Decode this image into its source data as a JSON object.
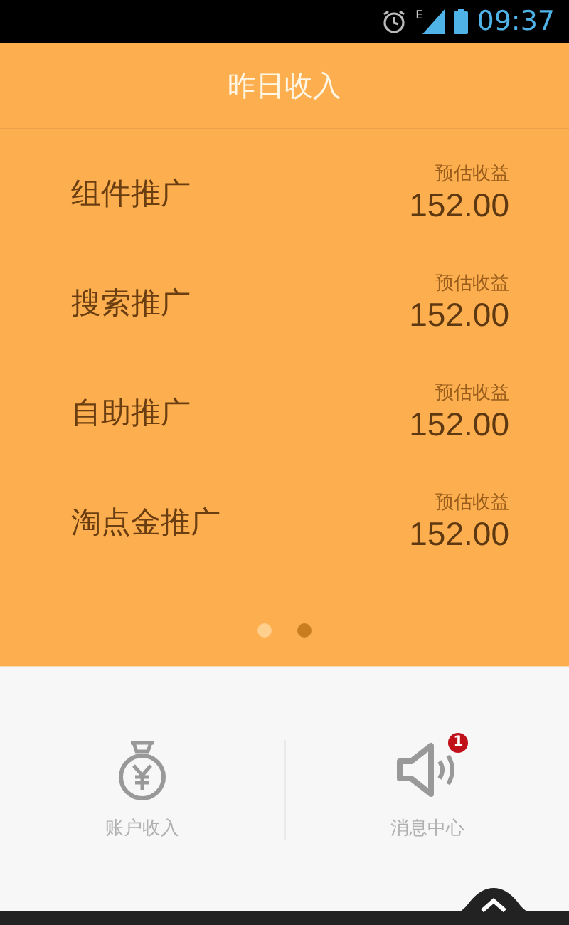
{
  "status_bar": {
    "network": "E",
    "time": "09:37"
  },
  "header": {
    "title": "昨日收入"
  },
  "rows": [
    {
      "name": "组件推广",
      "caption": "预估收益",
      "amount": "152.00"
    },
    {
      "name": "搜索推广",
      "caption": "预估收益",
      "amount": "152.00"
    },
    {
      "name": "自助推广",
      "caption": "预估收益",
      "amount": "152.00"
    },
    {
      "name": "淘点金推广",
      "caption": "预估收益",
      "amount": "152.00"
    }
  ],
  "pager": [
    {
      "selected": false
    },
    {
      "selected": true
    }
  ],
  "bottom_nav": [
    {
      "kind": "money",
      "label": "账户收入"
    },
    {
      "kind": "speaker",
      "label": "消息中心",
      "badge": "1"
    }
  ]
}
